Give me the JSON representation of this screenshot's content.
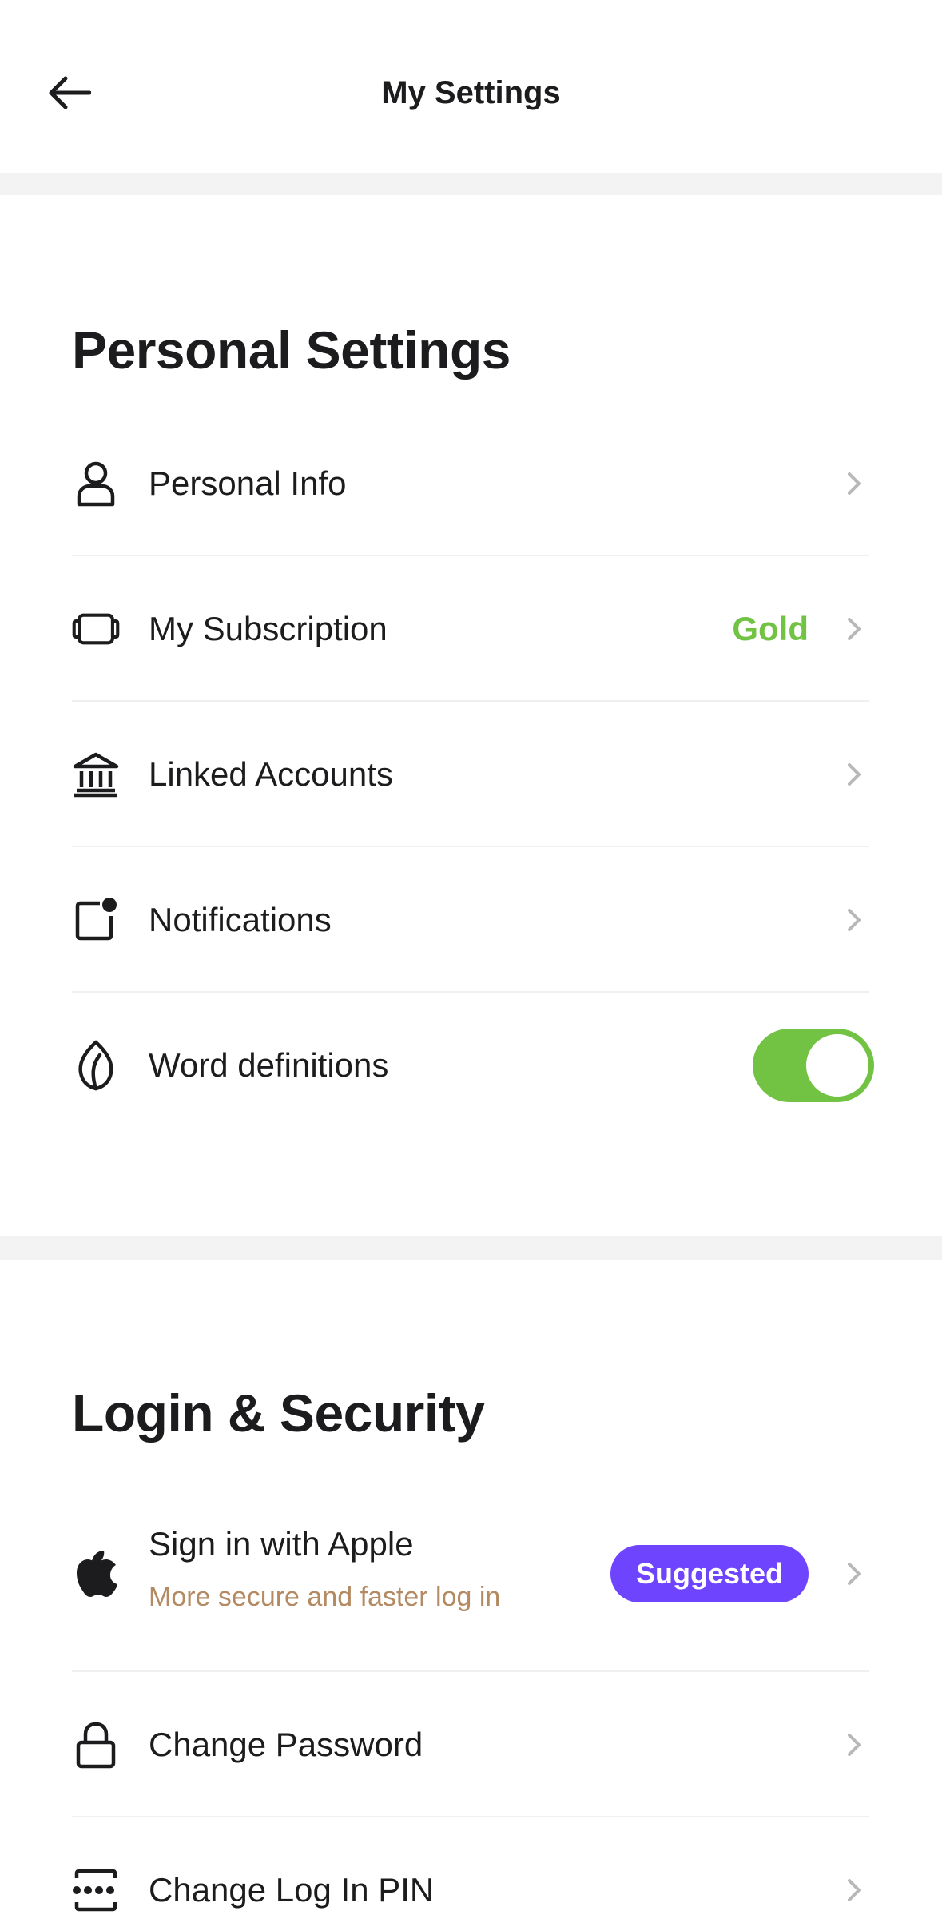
{
  "header": {
    "title": "My Settings",
    "back_icon": "arrow-left-icon"
  },
  "personal": {
    "title": "Personal Settings",
    "items": [
      {
        "label": "Personal Info",
        "icon": "person-icon"
      },
      {
        "label": "My Subscription",
        "icon": "subscription-icon",
        "value": "Gold"
      },
      {
        "label": "Linked Accounts",
        "icon": "bank-icon"
      },
      {
        "label": "Notifications",
        "icon": "notification-icon"
      },
      {
        "label": "Word definitions",
        "icon": "leaf-icon",
        "toggle_on": true
      }
    ]
  },
  "security": {
    "title": "Login & Security",
    "items": [
      {
        "label": "Sign in with Apple",
        "sublabel": "More secure and faster log in",
        "icon": "apple-icon",
        "badge": "Suggested"
      },
      {
        "label": "Change Password",
        "icon": "lock-icon"
      },
      {
        "label": "Change Log In PIN",
        "icon": "pin-icon"
      }
    ]
  },
  "colors": {
    "accent_green": "#72c243",
    "badge_purple": "#6e44ff",
    "sublabel_tan": "#b38a62",
    "band_gray": "#f3f3f3"
  }
}
